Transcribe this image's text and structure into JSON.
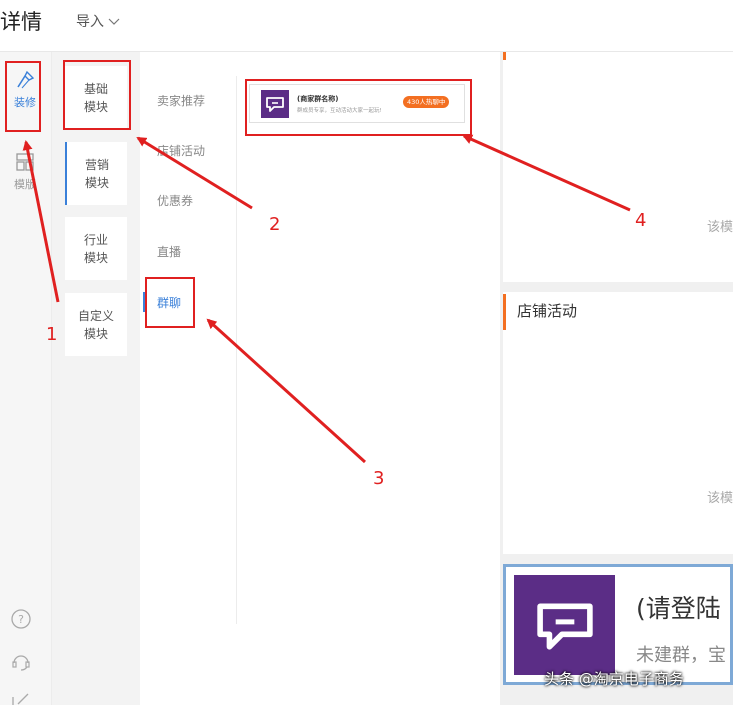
{
  "header": {
    "title": "详情",
    "import_label": "导入"
  },
  "rail": {
    "items": [
      {
        "label": "装修"
      },
      {
        "label": "模版"
      }
    ]
  },
  "categories": [
    {
      "label": "基础\n模块"
    },
    {
      "label": "营销\n模块"
    },
    {
      "label": "行业\n模块"
    },
    {
      "label": "自定义\n模块"
    }
  ],
  "subcategories": [
    {
      "label": "卖家推荐"
    },
    {
      "label": "店铺活动"
    },
    {
      "label": "优惠券"
    },
    {
      "label": "直播"
    },
    {
      "label": "群聊"
    }
  ],
  "group_card": {
    "name": "(商家群名称)",
    "desc": "群成员专享，互动活动大家一起玩!",
    "hot_badge": "430人热聊中"
  },
  "preview": {
    "module_note_1": "该模",
    "section_title": "店铺活动",
    "module_note_2": "该模",
    "chat_title": "(请登陆",
    "chat_desc": "未建群，宝"
  },
  "annotations": {
    "n1": "1",
    "n2": "2",
    "n3": "3",
    "n4": "4"
  },
  "watermark": "头条 @淘京电子商务",
  "colors": {
    "accent": "#3a80d9",
    "highlight": "#e02020",
    "brand_purple": "#5b2d86",
    "orange": "#f36f21"
  }
}
